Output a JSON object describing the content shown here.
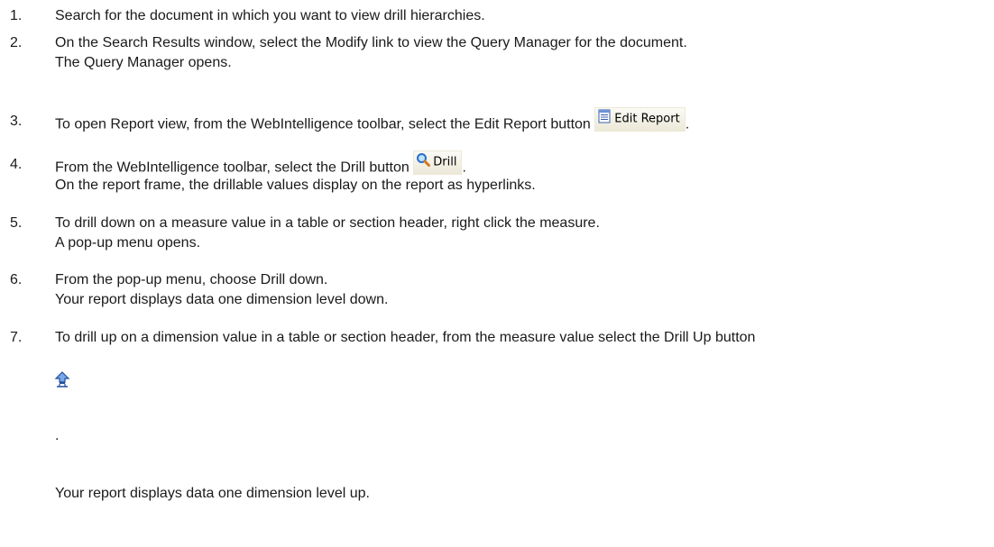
{
  "steps": [
    {
      "num": "1.",
      "lines": [
        "Search for the document in which you want to view drill hierarchies."
      ]
    },
    {
      "num": "2.",
      "lines": [
        "On the Search Results window, select the Modify link to view the Query Manager for the document.",
        "The Query Manager opens."
      ]
    },
    {
      "num": "3.",
      "lines": [
        "To open Report view, from the WebIntelligence toolbar, select the Edit Report button"
      ],
      "button_label": "Edit Report",
      "trailing": "."
    },
    {
      "num": "4.",
      "lines": [
        "From the WebIntelligence toolbar, select the Drill button",
        "On the report frame, the drillable values display on the report as hyperlinks."
      ],
      "button_label": "Drill",
      "trailing": "."
    },
    {
      "num": "5.",
      "lines": [
        "To drill down on a measure value in a table or section header, right click the measure.",
        "A pop-up menu opens."
      ]
    },
    {
      "num": "6.",
      "lines": [
        "From the pop-up menu, choose Drill down.",
        "Your report displays data one dimension level down."
      ]
    },
    {
      "num": "7.",
      "lines": [
        "To drill up on a dimension value in a table or section header, from the measure value select the Drill Up button",
        ".",
        "Your report displays data one dimension level up."
      ]
    }
  ],
  "icons": {
    "edit_report": "edit-report-icon",
    "drill": "magnifier-icon",
    "drill_up": "drill-up-arrow-icon"
  }
}
